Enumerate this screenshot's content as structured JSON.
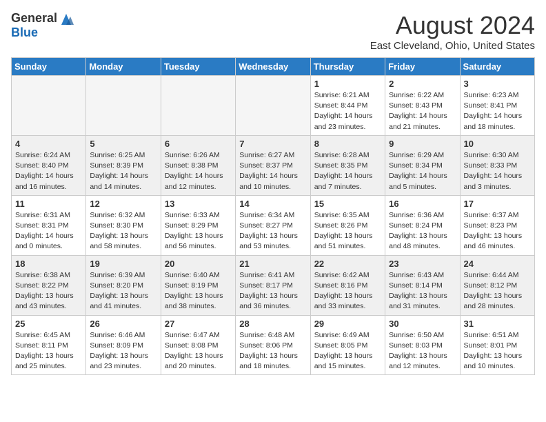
{
  "header": {
    "logo_general": "General",
    "logo_blue": "Blue",
    "month_title": "August 2024",
    "location": "East Cleveland, Ohio, United States"
  },
  "days_of_week": [
    "Sunday",
    "Monday",
    "Tuesday",
    "Wednesday",
    "Thursday",
    "Friday",
    "Saturday"
  ],
  "weeks": [
    [
      {
        "day": "",
        "info": "",
        "empty": true
      },
      {
        "day": "",
        "info": "",
        "empty": true
      },
      {
        "day": "",
        "info": "",
        "empty": true
      },
      {
        "day": "",
        "info": "",
        "empty": true
      },
      {
        "day": "1",
        "info": "Sunrise: 6:21 AM\nSunset: 8:44 PM\nDaylight: 14 hours\nand 23 minutes."
      },
      {
        "day": "2",
        "info": "Sunrise: 6:22 AM\nSunset: 8:43 PM\nDaylight: 14 hours\nand 21 minutes."
      },
      {
        "day": "3",
        "info": "Sunrise: 6:23 AM\nSunset: 8:41 PM\nDaylight: 14 hours\nand 18 minutes."
      }
    ],
    [
      {
        "day": "4",
        "info": "Sunrise: 6:24 AM\nSunset: 8:40 PM\nDaylight: 14 hours\nand 16 minutes."
      },
      {
        "day": "5",
        "info": "Sunrise: 6:25 AM\nSunset: 8:39 PM\nDaylight: 14 hours\nand 14 minutes."
      },
      {
        "day": "6",
        "info": "Sunrise: 6:26 AM\nSunset: 8:38 PM\nDaylight: 14 hours\nand 12 minutes."
      },
      {
        "day": "7",
        "info": "Sunrise: 6:27 AM\nSunset: 8:37 PM\nDaylight: 14 hours\nand 10 minutes."
      },
      {
        "day": "8",
        "info": "Sunrise: 6:28 AM\nSunset: 8:35 PM\nDaylight: 14 hours\nand 7 minutes."
      },
      {
        "day": "9",
        "info": "Sunrise: 6:29 AM\nSunset: 8:34 PM\nDaylight: 14 hours\nand 5 minutes."
      },
      {
        "day": "10",
        "info": "Sunrise: 6:30 AM\nSunset: 8:33 PM\nDaylight: 14 hours\nand 3 minutes."
      }
    ],
    [
      {
        "day": "11",
        "info": "Sunrise: 6:31 AM\nSunset: 8:31 PM\nDaylight: 14 hours\nand 0 minutes."
      },
      {
        "day": "12",
        "info": "Sunrise: 6:32 AM\nSunset: 8:30 PM\nDaylight: 13 hours\nand 58 minutes."
      },
      {
        "day": "13",
        "info": "Sunrise: 6:33 AM\nSunset: 8:29 PM\nDaylight: 13 hours\nand 56 minutes."
      },
      {
        "day": "14",
        "info": "Sunrise: 6:34 AM\nSunset: 8:27 PM\nDaylight: 13 hours\nand 53 minutes."
      },
      {
        "day": "15",
        "info": "Sunrise: 6:35 AM\nSunset: 8:26 PM\nDaylight: 13 hours\nand 51 minutes."
      },
      {
        "day": "16",
        "info": "Sunrise: 6:36 AM\nSunset: 8:24 PM\nDaylight: 13 hours\nand 48 minutes."
      },
      {
        "day": "17",
        "info": "Sunrise: 6:37 AM\nSunset: 8:23 PM\nDaylight: 13 hours\nand 46 minutes."
      }
    ],
    [
      {
        "day": "18",
        "info": "Sunrise: 6:38 AM\nSunset: 8:22 PM\nDaylight: 13 hours\nand 43 minutes."
      },
      {
        "day": "19",
        "info": "Sunrise: 6:39 AM\nSunset: 8:20 PM\nDaylight: 13 hours\nand 41 minutes."
      },
      {
        "day": "20",
        "info": "Sunrise: 6:40 AM\nSunset: 8:19 PM\nDaylight: 13 hours\nand 38 minutes."
      },
      {
        "day": "21",
        "info": "Sunrise: 6:41 AM\nSunset: 8:17 PM\nDaylight: 13 hours\nand 36 minutes."
      },
      {
        "day": "22",
        "info": "Sunrise: 6:42 AM\nSunset: 8:16 PM\nDaylight: 13 hours\nand 33 minutes."
      },
      {
        "day": "23",
        "info": "Sunrise: 6:43 AM\nSunset: 8:14 PM\nDaylight: 13 hours\nand 31 minutes."
      },
      {
        "day": "24",
        "info": "Sunrise: 6:44 AM\nSunset: 8:12 PM\nDaylight: 13 hours\nand 28 minutes."
      }
    ],
    [
      {
        "day": "25",
        "info": "Sunrise: 6:45 AM\nSunset: 8:11 PM\nDaylight: 13 hours\nand 25 minutes."
      },
      {
        "day": "26",
        "info": "Sunrise: 6:46 AM\nSunset: 8:09 PM\nDaylight: 13 hours\nand 23 minutes."
      },
      {
        "day": "27",
        "info": "Sunrise: 6:47 AM\nSunset: 8:08 PM\nDaylight: 13 hours\nand 20 minutes."
      },
      {
        "day": "28",
        "info": "Sunrise: 6:48 AM\nSunset: 8:06 PM\nDaylight: 13 hours\nand 18 minutes."
      },
      {
        "day": "29",
        "info": "Sunrise: 6:49 AM\nSunset: 8:05 PM\nDaylight: 13 hours\nand 15 minutes."
      },
      {
        "day": "30",
        "info": "Sunrise: 6:50 AM\nSunset: 8:03 PM\nDaylight: 13 hours\nand 12 minutes."
      },
      {
        "day": "31",
        "info": "Sunrise: 6:51 AM\nSunset: 8:01 PM\nDaylight: 13 hours\nand 10 minutes."
      }
    ]
  ]
}
